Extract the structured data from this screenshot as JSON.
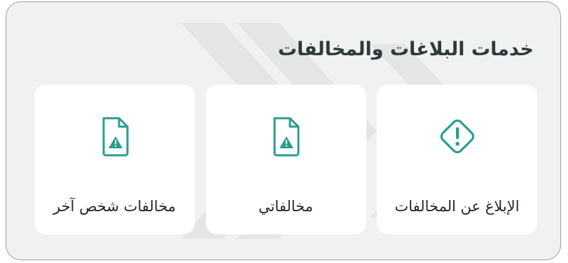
{
  "section": {
    "title": "خدمات البلاغات والمخالفات"
  },
  "cards": [
    {
      "label": "الإبلاغ عن المخالفات",
      "icon": "warning-diamond-icon"
    },
    {
      "label": "مخالفاتي",
      "icon": "document-warning-icon"
    },
    {
      "label": "مخالفات شخص آخر",
      "icon": "document-warning-icon"
    }
  ],
  "colors": {
    "accent": "#2a9d8f",
    "panel_background": "#f0f1f1",
    "card_background": "#ffffff",
    "title_text": "#2f3a3e",
    "border": "#9aa0a2"
  }
}
